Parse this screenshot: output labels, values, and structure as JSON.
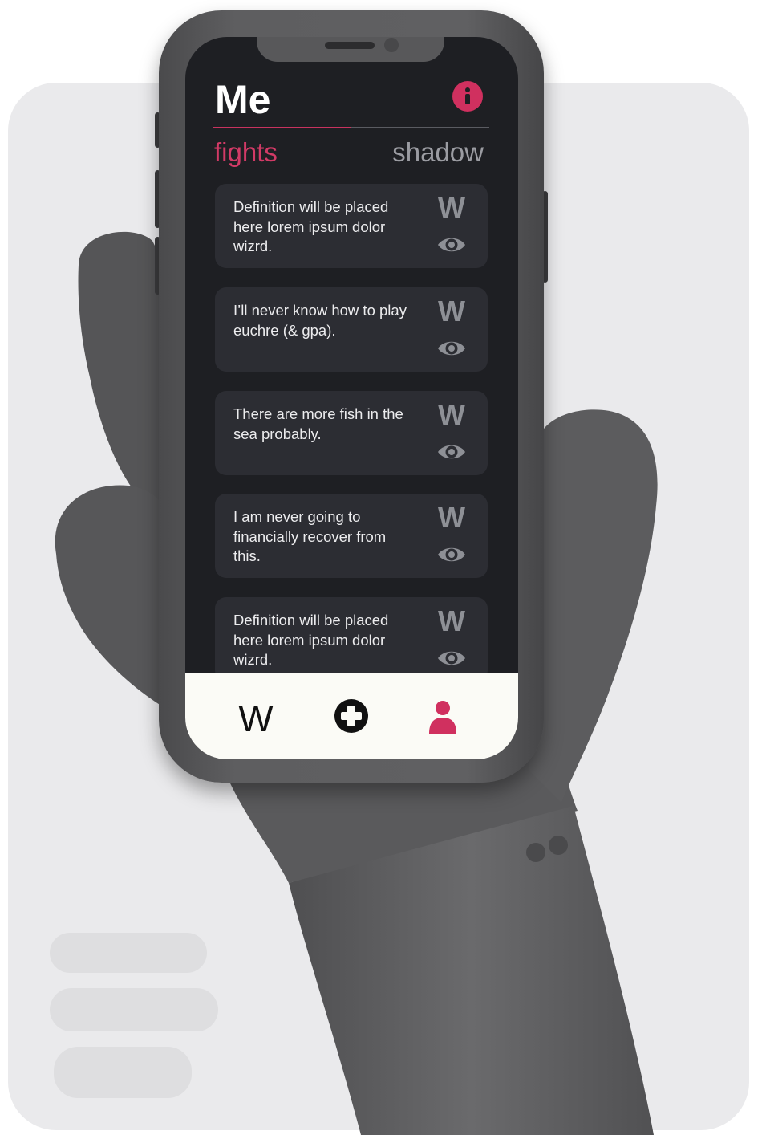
{
  "header": {
    "title": "Me",
    "info_icon": "info-icon"
  },
  "tabs": [
    {
      "label": "fights",
      "active": true
    },
    {
      "label": "shadow",
      "active": false
    }
  ],
  "cards": [
    {
      "text": "Definition will be placed here lorem ipsum dolor wizrd.",
      "badge": "W",
      "icon": "eye-icon"
    },
    {
      "text": "I’ll never know how to play euchre (& gpa).",
      "badge": "W",
      "icon": "eye-icon"
    },
    {
      "text": "There are more fish in the sea probably.",
      "badge": "W",
      "icon": "eye-icon"
    },
    {
      "text": "I am never going to financially recover from this.",
      "badge": "W",
      "icon": "eye-icon"
    },
    {
      "text": "Definition will be placed here lorem ipsum dolor wizrd.",
      "badge": "W",
      "icon": "eye-icon"
    }
  ],
  "bottom_nav": {
    "home_label": "W",
    "add_icon": "plus-circle-icon",
    "profile_icon": "person-icon"
  },
  "colors": {
    "accent": "#d0305f",
    "screen_background": "#1e1f23",
    "card_background": "#2c2d33",
    "nav_background": "#fbfbf6"
  }
}
